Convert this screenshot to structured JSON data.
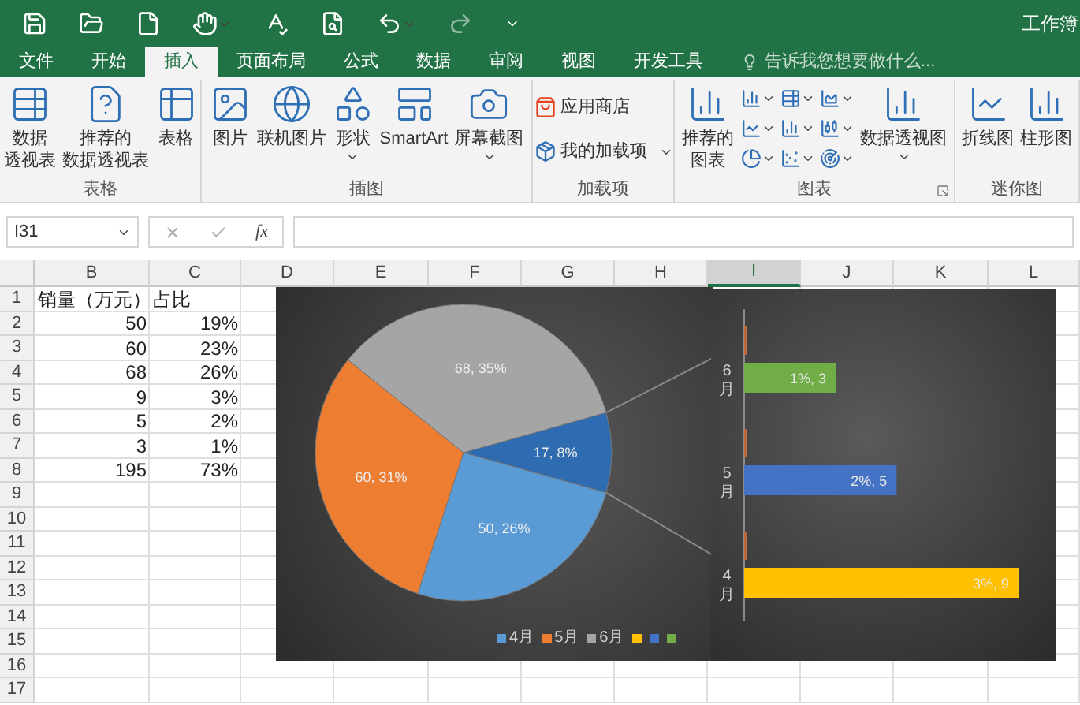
{
  "title_bar": {
    "title": "工作簿"
  },
  "tabs": [
    {
      "label": "文件",
      "selected": false
    },
    {
      "label": "开始",
      "selected": false
    },
    {
      "label": "插入",
      "selected": true
    },
    {
      "label": "页面布局",
      "selected": false
    },
    {
      "label": "公式",
      "selected": false
    },
    {
      "label": "数据",
      "selected": false
    },
    {
      "label": "审阅",
      "selected": false
    },
    {
      "label": "视图",
      "selected": false
    },
    {
      "label": "开发工具",
      "selected": false
    }
  ],
  "search": {
    "placeholder": "告诉我您想要做什么..."
  },
  "ribbon_groups": [
    {
      "label": "表格",
      "buttons": [
        {
          "lines": [
            "数据",
            "透视表"
          ],
          "has_menu": false
        },
        {
          "lines": [
            "推荐的",
            "数据透视表"
          ],
          "has_menu": false
        },
        {
          "lines": [
            "表格"
          ],
          "has_menu": false
        }
      ]
    },
    {
      "label": "插图",
      "buttons": [
        {
          "lines": [
            "图片"
          ],
          "has_menu": false
        },
        {
          "lines": [
            "联机图片"
          ],
          "has_menu": false
        },
        {
          "lines": [
            "形状"
          ],
          "has_menu": true
        },
        {
          "lines": [
            "SmartArt"
          ],
          "has_menu": false
        },
        {
          "lines": [
            "屏幕截图"
          ],
          "has_menu": true
        }
      ]
    },
    {
      "label": "加载项",
      "buttons": [
        {
          "lines": [
            "应用商店"
          ],
          "has_menu": false
        },
        {
          "lines": [
            "我的加载项"
          ],
          "has_menu": true
        }
      ]
    },
    {
      "label": "图表",
      "buttons": [
        {
          "lines": [
            "推荐的",
            "图表"
          ],
          "has_menu": false
        },
        {
          "lines": [
            "数据透视图"
          ],
          "has_menu": true
        }
      ]
    },
    {
      "label": "迷你图",
      "buttons": [
        {
          "lines": [
            "折线图"
          ],
          "has_menu": false
        },
        {
          "lines": [
            "柱形图"
          ],
          "has_menu": false
        }
      ]
    }
  ],
  "formula_bar": {
    "name_box": "I31",
    "fx": "fx"
  },
  "columns": [
    {
      "label": "B",
      "selected": false
    },
    {
      "label": "C",
      "selected": false
    },
    {
      "label": "D",
      "selected": false
    },
    {
      "label": "E",
      "selected": false
    },
    {
      "label": "F",
      "selected": false
    },
    {
      "label": "G",
      "selected": false
    },
    {
      "label": "H",
      "selected": false
    },
    {
      "label": "I",
      "selected": true
    },
    {
      "label": "J",
      "selected": false
    },
    {
      "label": "K",
      "selected": false
    },
    {
      "label": "L",
      "selected": false
    }
  ],
  "rows": [
    {
      "number": "1",
      "cells": [
        "销量（万元）",
        "占比"
      ]
    },
    {
      "number": "2",
      "cells": [
        "50",
        "19%"
      ]
    },
    {
      "number": "3",
      "cells": [
        "60",
        "23%"
      ]
    },
    {
      "number": "4",
      "cells": [
        "68",
        "26%"
      ]
    },
    {
      "number": "5",
      "cells": [
        "9",
        "3%"
      ]
    },
    {
      "number": "6",
      "cells": [
        "5",
        "2%"
      ]
    },
    {
      "number": "7",
      "cells": [
        "3",
        "1%"
      ]
    },
    {
      "number": "8",
      "cells": [
        "195",
        "73%"
      ]
    },
    {
      "number": "9",
      "cells": []
    },
    {
      "number": "10",
      "cells": []
    },
    {
      "number": "11",
      "cells": []
    },
    {
      "number": "12",
      "cells": []
    },
    {
      "number": "13",
      "cells": []
    },
    {
      "number": "14",
      "cells": []
    },
    {
      "number": "15",
      "cells": []
    },
    {
      "number": "16",
      "cells": []
    },
    {
      "number": "17",
      "cells": []
    }
  ],
  "pie_chart": {
    "chart_data": {
      "type": "pie",
      "values": [
        17,
        50,
        60,
        68
      ],
      "colors": [
        "#2e6bb0",
        "#5b9bd5",
        "#ed7d31",
        "#a5a5a5"
      ],
      "value_labels": [
        "17, 8%",
        "50, 26%",
        "60, 31%",
        "68, 35%"
      ]
    },
    "legend": [
      {
        "label": "4月",
        "color": "#5b9bd5"
      },
      {
        "label": "5月",
        "color": "#ed7d31"
      },
      {
        "label": "6月",
        "color": "#a5a5a5"
      },
      {
        "color": "#ffc000"
      },
      {
        "color": "#4472c4"
      },
      {
        "color": "#70ad47"
      }
    ]
  },
  "bar_chart": {
    "chart_data": {
      "type": "bar",
      "orientation": "horizontal",
      "categories": [
        "6月",
        "5月",
        "4月"
      ],
      "values": [
        3,
        5,
        9
      ],
      "colors": [
        "#70ad47",
        "#4472c4",
        "#ffc000"
      ],
      "value_labels": [
        "1%, 3",
        "2%, 5",
        "3%, 9"
      ]
    }
  }
}
